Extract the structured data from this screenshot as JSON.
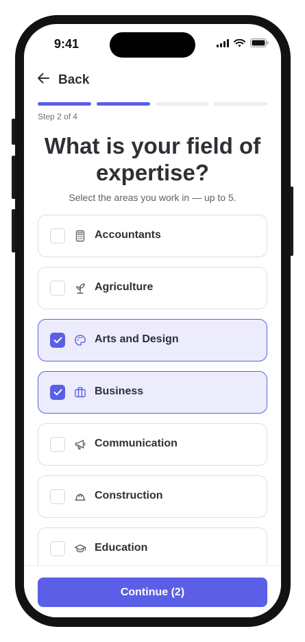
{
  "status_bar": {
    "time": "9:41"
  },
  "header": {
    "back_label": "Back"
  },
  "progress": {
    "current_step": 2,
    "total_steps": 4,
    "label": "Step 2 of 4"
  },
  "title": "What is your field of expertise?",
  "subtitle": "Select the areas you work in — up to 5.",
  "options": [
    {
      "label": "Accountants",
      "icon": "calculator-icon",
      "selected": false
    },
    {
      "label": "Agriculture",
      "icon": "sprout-icon",
      "selected": false
    },
    {
      "label": "Arts and Design",
      "icon": "palette-icon",
      "selected": true
    },
    {
      "label": "Business",
      "icon": "briefcase-icon",
      "selected": true
    },
    {
      "label": "Communication",
      "icon": "megaphone-icon",
      "selected": false
    },
    {
      "label": "Construction",
      "icon": "hard-hat-icon",
      "selected": false
    },
    {
      "label": "Education",
      "icon": "graduation-cap-icon",
      "selected": false
    }
  ],
  "footer": {
    "continue_label": "Continue (2)"
  },
  "colors": {
    "accent": "#5b5ee6",
    "selected_background": "#ececfd",
    "text": "#2f3036",
    "muted_text": "#6b6e76",
    "border": "#dcdde3"
  }
}
